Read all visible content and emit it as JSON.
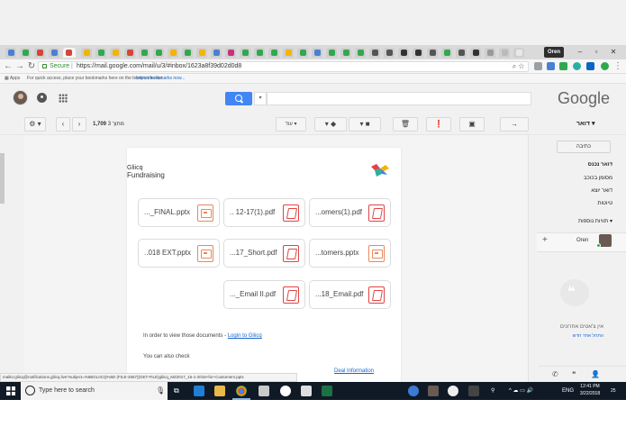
{
  "browser": {
    "profile_name": "Oren",
    "url_secure_label": "Secure",
    "url_separator": "|",
    "url": "https://mail.google.com/mail/u/3/#inbox/1623a8f39d02d0d8",
    "bookmarks_apps": "Apps",
    "bookmarks_hint": "For quick access, place your bookmarks here on the bookmarks bar.",
    "bookmarks_import": "Import bookmarks now...",
    "window_minimize": "–",
    "window_maximize": "▫",
    "window_close": "✕"
  },
  "gmail": {
    "logo_text": "Google",
    "mail_menu_label": "דואר ▾",
    "compose_label": "כתיבה",
    "pagination_count_bold": "1,709",
    "pagination_count_rest": " מתוך 3",
    "more_button_label": "עוד ▾",
    "nav": [
      {
        "label": "דואר נכנס",
        "bold": true
      },
      {
        "label": "מסומן בכוכב",
        "bold": false
      },
      {
        "label": "דואר יוצא",
        "bold": false
      },
      {
        "label": "טיוטות",
        "bold": false
      }
    ],
    "more_labels": "תוויות נוספות ▾",
    "contact_name": "Oren",
    "chat_empty": "אין צ'אטים אחרונים",
    "chat_start": "התחל אחד חדש"
  },
  "email": {
    "brand_name": "Gliicq",
    "brand_sub": "Fundraising",
    "files": [
      {
        "name": "..._FINAL.pptx",
        "type": "ppt"
      },
      {
        "name": ".. 12-17(1).pdf",
        "type": "pdf"
      },
      {
        "name": "...omers(1).pdf",
        "type": "pdf"
      },
      {
        "name": "..018 EXT.pptx",
        "type": "ppt"
      },
      {
        "name": "...17_Short.pdf",
        "type": "pdf"
      },
      {
        "name": "...tomers.pptx",
        "type": "ppt"
      },
      {
        "name": "..._Email II.pdf",
        "type": "pdf"
      },
      {
        "name": "...18_Email.pdf",
        "type": "pdf"
      }
    ],
    "view_text": "In order to view those documents - ",
    "login_link": "Login to Gliicq",
    "also_check": "You can also check",
    "deal_info": "Deal Information"
  },
  "statusbar": {
    "text": "mailto:gliicq@notifications.gliicq.live?subject=%5BGLIICQ%5D (FILE-2657)(GET-FILE)gliicq_MZ2017_15-1-2018+for+Customers.pptx"
  },
  "taskbar": {
    "search_placeholder": "Type here to search",
    "language": "ENG",
    "time": "12:41 PM",
    "date": "3/22/2018",
    "notifications": "25"
  },
  "colors": {
    "gmail_blue": "#4285f4",
    "link_blue": "#1a66c9",
    "pdf_red": "#e04444",
    "ppt_orange": "#e58a5a",
    "taskbar_bg": "#101a26",
    "secure_green": "#2c8a2c"
  },
  "icons": {
    "settings": "gear-icon",
    "notifications": "bell-icon",
    "apps": "apps-grid-icon",
    "search": "search-icon",
    "archive": "archive-icon",
    "spam": "exclamation-icon",
    "delete": "trash-icon",
    "labels": "tag-icon",
    "move": "folder-icon"
  }
}
